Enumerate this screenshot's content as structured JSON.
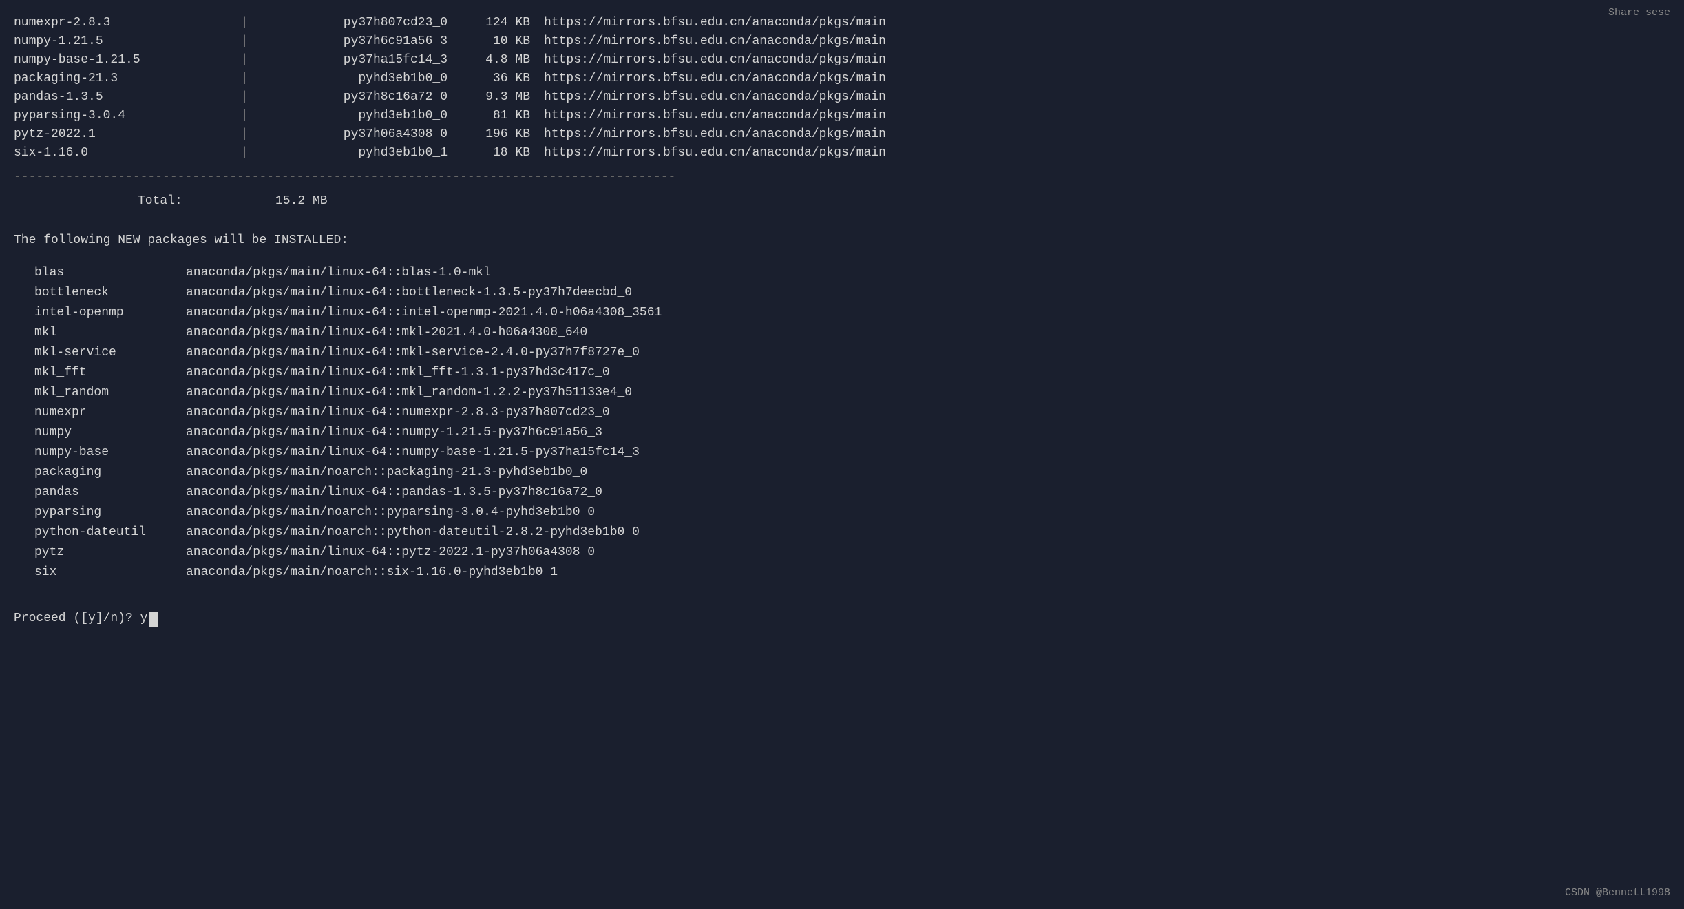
{
  "share_button": "Share sese",
  "packages_table": {
    "rows": [
      {
        "pkg": "numexpr-2.8.3",
        "build": "py37h807cd23_0",
        "size": "124 KB",
        "url": "https://mirrors.bfsu.edu.cn/anaconda/pkgs/main"
      },
      {
        "pkg": "numpy-1.21.5",
        "build": "py37h6c91a56_3",
        "size": "10 KB",
        "url": "https://mirrors.bfsu.edu.cn/anaconda/pkgs/main"
      },
      {
        "pkg": "numpy-base-1.21.5",
        "build": "py37ha15fc14_3",
        "size": "4.8 MB",
        "url": "https://mirrors.bfsu.edu.cn/anaconda/pkgs/main"
      },
      {
        "pkg": "packaging-21.3",
        "build": "pyhd3eb1b0_0",
        "size": "36 KB",
        "url": "https://mirrors.bfsu.edu.cn/anaconda/pkgs/main"
      },
      {
        "pkg": "pandas-1.3.5",
        "build": "py37h8c16a72_0",
        "size": "9.3 MB",
        "url": "https://mirrors.bfsu.edu.cn/anaconda/pkgs/main"
      },
      {
        "pkg": "pyparsing-3.0.4",
        "build": "pyhd3eb1b0_0",
        "size": "81 KB",
        "url": "https://mirrors.bfsu.edu.cn/anaconda/pkgs/main"
      },
      {
        "pkg": "pytz-2022.1",
        "build": "py37h06a4308_0",
        "size": "196 KB",
        "url": "https://mirrors.bfsu.edu.cn/anaconda/pkgs/main"
      },
      {
        "pkg": "six-1.16.0",
        "build": "pyhd3eb1b0_1",
        "size": "18 KB",
        "url": "https://mirrors.bfsu.edu.cn/anaconda/pkgs/main"
      }
    ],
    "total_label": "Total:",
    "total_value": "15.2 MB"
  },
  "install_header": "The following NEW packages will be INSTALLED:",
  "install_packages": [
    {
      "pkg": "blas",
      "path": "anaconda/pkgs/main/linux-64::blas-1.0-mkl"
    },
    {
      "pkg": "bottleneck",
      "path": "anaconda/pkgs/main/linux-64::bottleneck-1.3.5-py37h7deecbd_0"
    },
    {
      "pkg": "intel-openmp",
      "path": "anaconda/pkgs/main/linux-64::intel-openmp-2021.4.0-h06a4308_3561"
    },
    {
      "pkg": "mkl",
      "path": "anaconda/pkgs/main/linux-64::mkl-2021.4.0-h06a4308_640"
    },
    {
      "pkg": "mkl-service",
      "path": "anaconda/pkgs/main/linux-64::mkl-service-2.4.0-py37h7f8727e_0"
    },
    {
      "pkg": "mkl_fft",
      "path": "anaconda/pkgs/main/linux-64::mkl_fft-1.3.1-py37hd3c417c_0"
    },
    {
      "pkg": "mkl_random",
      "path": "anaconda/pkgs/main/linux-64::mkl_random-1.2.2-py37h51133e4_0"
    },
    {
      "pkg": "numexpr",
      "path": "anaconda/pkgs/main/linux-64::numexpr-2.8.3-py37h807cd23_0"
    },
    {
      "pkg": "numpy",
      "path": "anaconda/pkgs/main/linux-64::numpy-1.21.5-py37h6c91a56_3"
    },
    {
      "pkg": "numpy-base",
      "path": "anaconda/pkgs/main/linux-64::numpy-base-1.21.5-py37ha15fc14_3"
    },
    {
      "pkg": "packaging",
      "path": "anaconda/pkgs/main/noarch::packaging-21.3-pyhd3eb1b0_0"
    },
    {
      "pkg": "pandas",
      "path": "anaconda/pkgs/main/linux-64::pandas-1.3.5-py37h8c16a72_0"
    },
    {
      "pkg": "pyparsing",
      "path": "anaconda/pkgs/main/noarch::pyparsing-3.0.4-pyhd3eb1b0_0"
    },
    {
      "pkg": "python-dateutil",
      "path": "anaconda/pkgs/main/noarch::python-dateutil-2.8.2-pyhd3eb1b0_0"
    },
    {
      "pkg": "pytz",
      "path": "anaconda/pkgs/main/linux-64::pytz-2022.1-py37h06a4308_0"
    },
    {
      "pkg": "six",
      "path": "anaconda/pkgs/main/noarch::six-1.16.0-pyhd3eb1b0_1"
    }
  ],
  "proceed_prompt": "Proceed ([y]/n)? y",
  "csdn_badge": "CSDN @Bennett1998"
}
